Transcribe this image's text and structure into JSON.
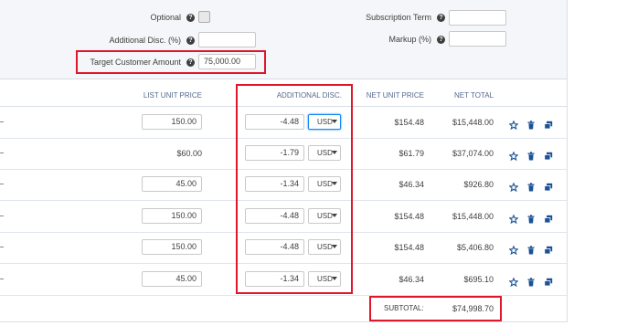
{
  "header_fields": {
    "optional_label": "Optional",
    "additional_disc_label": "Additional Disc. (%)",
    "additional_disc_value": "",
    "target_customer_amount_label": "Target Customer Amount",
    "target_customer_amount_value": "75,000.00",
    "subscription_term_label": "Subscription Term",
    "subscription_term_value": "",
    "markup_label": "Markup (%)",
    "markup_value": ""
  },
  "columns": {
    "list_unit_price": "LIST UNIT PRICE",
    "additional_disc": "ADDITIONAL DISC.",
    "net_unit_price": "NET UNIT PRICE",
    "net_total": "NET TOTAL"
  },
  "rows": [
    {
      "list_price": "150.00",
      "list_editable": true,
      "disc": "-4.48",
      "currency": "USD",
      "net_unit": "$154.48",
      "net_total": "$15,448.00"
    },
    {
      "list_price": "$60.00",
      "list_editable": false,
      "disc": "-1.79",
      "currency": "USD",
      "net_unit": "$61.79",
      "net_total": "$37,074.00"
    },
    {
      "list_price": "45.00",
      "list_editable": true,
      "disc": "-1.34",
      "currency": "USD",
      "net_unit": "$46.34",
      "net_total": "$926.80"
    },
    {
      "list_price": "150.00",
      "list_editable": true,
      "disc": "-4.48",
      "currency": "USD",
      "net_unit": "$154.48",
      "net_total": "$15,448.00"
    },
    {
      "list_price": "150.00",
      "list_editable": true,
      "disc": "-4.48",
      "currency": "USD",
      "net_unit": "$154.48",
      "net_total": "$5,406.80"
    },
    {
      "list_price": "45.00",
      "list_editable": true,
      "disc": "-1.34",
      "currency": "USD",
      "net_unit": "$46.34",
      "net_total": "$695.10"
    }
  ],
  "row_icons": [
    "star-icon",
    "trash-icon",
    "clone-icon"
  ],
  "subtotal": {
    "label": "SUBTOTAL:",
    "value": "$74,998.70"
  },
  "colors": {
    "accent": "#1b5297",
    "highlight": "#e0162b",
    "focus": "#1589ee"
  }
}
